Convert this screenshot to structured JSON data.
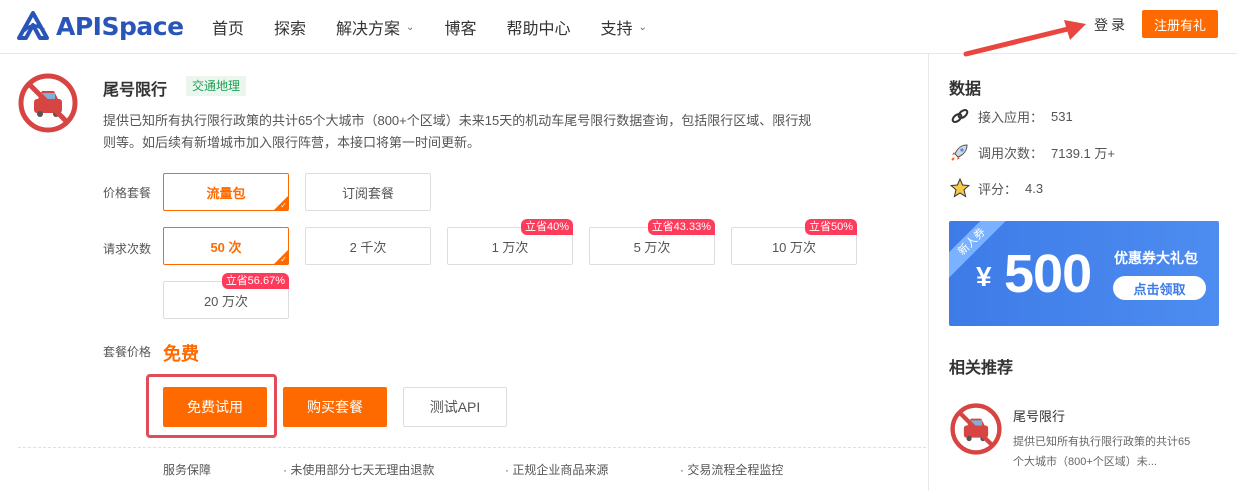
{
  "header": {
    "brand": "APISpace",
    "nav": [
      {
        "label": "首页",
        "dropdown": false
      },
      {
        "label": "探索",
        "dropdown": false
      },
      {
        "label": "解决方案",
        "dropdown": true
      },
      {
        "label": "博客",
        "dropdown": false
      },
      {
        "label": "帮助中心",
        "dropdown": false
      },
      {
        "label": "支持",
        "dropdown": true
      }
    ],
    "login": "登录",
    "register": "注册有礼"
  },
  "api": {
    "title": "尾号限行",
    "tag": "交通地理",
    "description": "提供已知所有执行限行政策的共计65个大城市（800+个区域）未来15天的机动车尾号限行数据查询，包括限行区域、限行规则等。如后续有新增城市加入限行阵营，本接口将第一时间更新。"
  },
  "pricing": {
    "package_label": "价格套餐",
    "packages": [
      {
        "label": "流量包",
        "active": true
      },
      {
        "label": "订阅套餐",
        "active": false
      }
    ],
    "requests_label": "请求次数",
    "requests": [
      {
        "label": "50 次",
        "active": true,
        "badge": ""
      },
      {
        "label": "2 千次",
        "active": false,
        "badge": ""
      },
      {
        "label": "1 万次",
        "active": false,
        "badge": "立省40%"
      },
      {
        "label": "5 万次",
        "active": false,
        "badge": "立省43.33%"
      },
      {
        "label": "10 万次",
        "active": false,
        "badge": "立省50%"
      },
      {
        "label": "20 万次",
        "active": false,
        "badge": "立省56.67%"
      }
    ],
    "price_label": "套餐价格",
    "price_value": "免费"
  },
  "actions": {
    "free_trial": "免费试用",
    "buy": "购买套餐",
    "test_api": "测试API"
  },
  "guarantees": {
    "label": "服务保障",
    "items": [
      "· 未使用部分七天无理由退款",
      "· 正规企业商品来源",
      "· 交易流程全程监控"
    ]
  },
  "sidebar": {
    "data_title": "数据",
    "stats": [
      {
        "label": "接入应用：",
        "value": "531",
        "icon": "link-icon"
      },
      {
        "label": "调用次数：",
        "value": "7139.1 万+",
        "icon": "rocket-icon"
      },
      {
        "label": "评分：",
        "value": "4.3",
        "icon": "star-icon"
      }
    ],
    "coupon": {
      "ribbon": "新人券",
      "currency": "¥",
      "amount": "500",
      "title": "优惠券大礼包",
      "button": "点击领取"
    },
    "related_title": "相关推荐",
    "related": {
      "title": "尾号限行",
      "description": "提供已知所有执行限行政策的共计65个大城市（800+个区域）未..."
    }
  },
  "colors": {
    "brand": "#2a55b8",
    "accent": "#ff6a00",
    "badge": "#ff3b5c",
    "tag_green": "#23a056",
    "coupon_blue": "#3e7be8",
    "highlight_red": "#e24b58"
  }
}
